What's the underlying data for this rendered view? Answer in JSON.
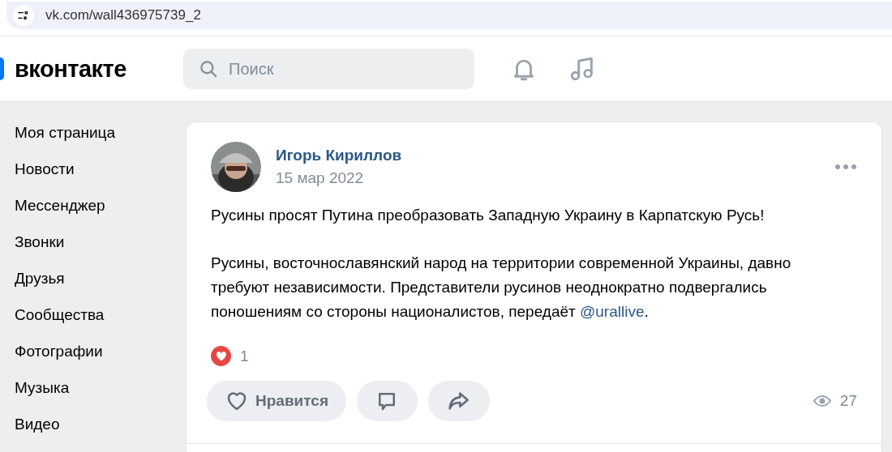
{
  "browser": {
    "url": "vk.com/wall436975739_2"
  },
  "header": {
    "logo": "вконтакте",
    "search": {
      "placeholder": "Поиск"
    }
  },
  "sidebar": {
    "items": [
      {
        "label": "Моя страница"
      },
      {
        "label": "Новости"
      },
      {
        "label": "Мессенджер"
      },
      {
        "label": "Звонки"
      },
      {
        "label": "Друзья"
      },
      {
        "label": "Сообщества"
      },
      {
        "label": "Фотографии"
      },
      {
        "label": "Музыка"
      },
      {
        "label": "Видео"
      }
    ]
  },
  "post": {
    "author": "Игорь Кириллов",
    "date": "15 мар 2022",
    "avatar": {
      "kind": "picture"
    },
    "paragraphs": [
      [
        {
          "kind": "text",
          "text": "Русины просят Путина преобразовать Западную Украину в Карпатскую Русь!"
        }
      ],
      [
        {
          "kind": "text",
          "text": "Русины, восточнославянский народ на территории современной Украины, давно требуют независимости. Представители русинов неоднократно подвергались поношениям со стороны националистов, передаёт "
        },
        {
          "kind": "link",
          "text": "@urallive"
        },
        {
          "kind": "text",
          "text": "."
        }
      ]
    ],
    "reactions": {
      "count": "1"
    },
    "actions": [
      {
        "kind": "like",
        "label": "Нравится"
      },
      {
        "kind": "comment"
      },
      {
        "kind": "share"
      }
    ],
    "views": "27"
  }
}
